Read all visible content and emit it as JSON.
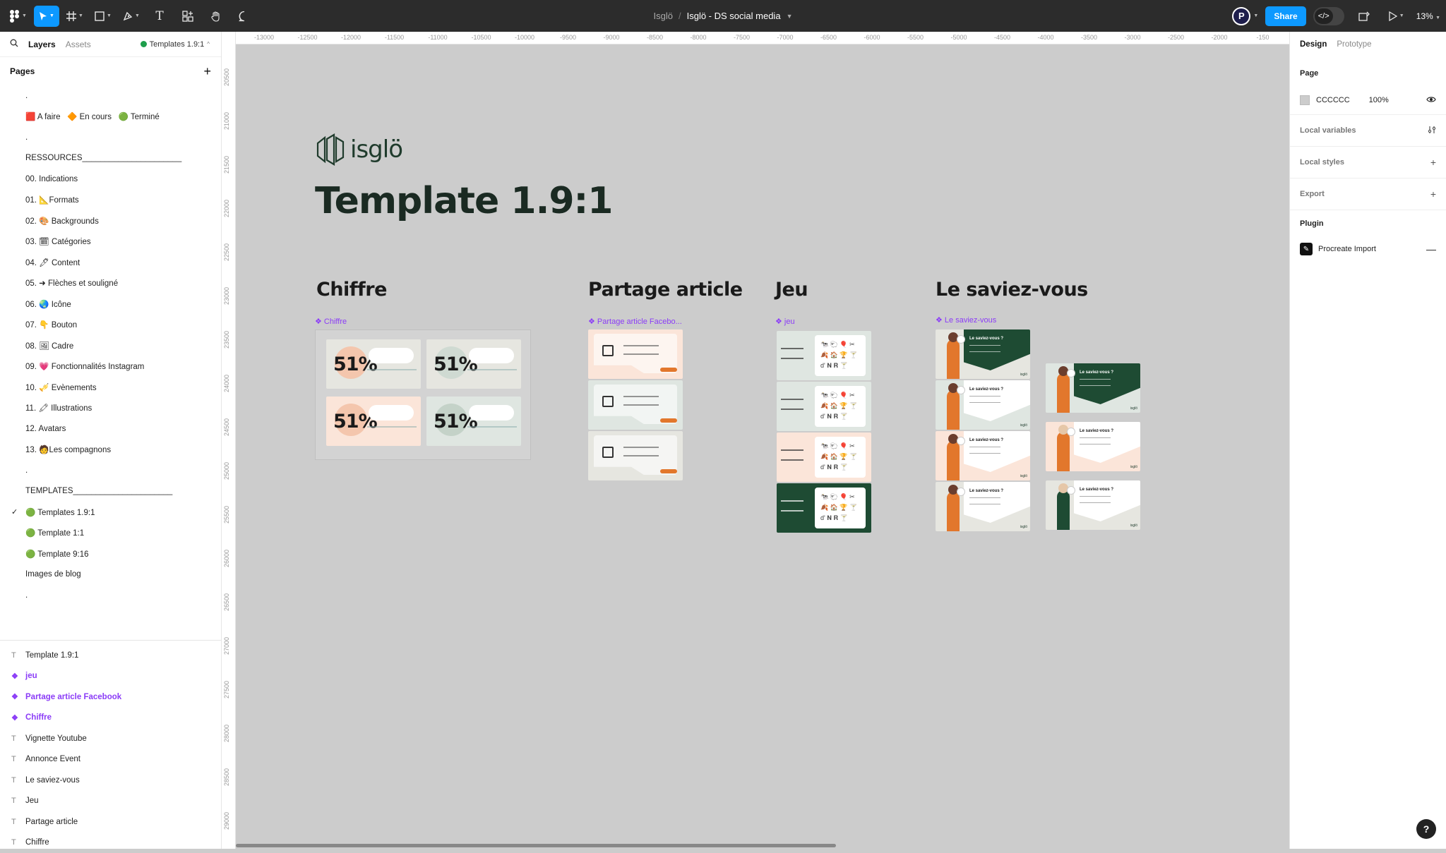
{
  "toolbar": {
    "breadcrumb_team": "Isglö",
    "breadcrumb_sep": "/",
    "breadcrumb_file": "Isglö - DS social media",
    "avatar_letter": "P",
    "share_label": "Share",
    "devmode_icon": "</>",
    "zoom_label": "13%",
    "tool_icons": [
      "figma-menu-icon",
      "move-tool-icon",
      "frame-tool-icon",
      "shape-tool-icon",
      "pen-tool-icon",
      "text-tool-icon",
      "components-icon",
      "hand-tool-icon",
      "comment-tool-icon"
    ],
    "text_tool_glyph": "T"
  },
  "left_panel": {
    "tab_layers": "Layers",
    "tab_assets": "Assets",
    "page_selector": "Templates 1.9:1",
    "pages_heading": "Pages",
    "pages": [
      ".",
      "🟥 A faire   🔶 En cours   🟢 Terminé",
      ".",
      "RESSOURCES______________________",
      "00. Indications",
      "01. 📐Formats",
      "02. 🎨 Backgrounds",
      "03. 🗓 Catégories",
      "04. 🖊 Content",
      "05. ➜ Flèches et souligné",
      "06. 🌏 Icône",
      "07. 👇 Bouton",
      "08. 🖼 Cadre",
      "09. 💗 Fonctionnalités Instagram",
      "10. 🎺 Evènements",
      "11. 🖍 Illustrations",
      "12. Avatars",
      "13. 🧑Les compagnons",
      ".",
      "TEMPLATES______________________",
      "🟢 Templates 1.9:1",
      "🟢 Template 1:1",
      "🟢 Template 9:16",
      "Images de blog",
      "."
    ],
    "active_page_index": 20,
    "layers": [
      {
        "label": "Template 1.9:1",
        "type": "text"
      },
      {
        "label": "jeu",
        "type": "component"
      },
      {
        "label": "Partage article Facebook",
        "type": "component"
      },
      {
        "label": "Chiffre",
        "type": "component"
      },
      {
        "label": "Vignette Youtube",
        "type": "text"
      },
      {
        "label": "Annonce Event",
        "type": "text"
      },
      {
        "label": "Le saviez-vous",
        "type": "text"
      },
      {
        "label": "Jeu",
        "type": "text"
      },
      {
        "label": "Partage article",
        "type": "text"
      },
      {
        "label": "Chiffre",
        "type": "text"
      }
    ]
  },
  "canvas": {
    "ruler_x": [
      "-13000",
      "-12500",
      "-12000",
      "-11500",
      "-11000",
      "-10500",
      "-10000",
      "-9500",
      "-9000",
      "-8500",
      "-8000",
      "-7500",
      "-7000",
      "-6500",
      "-6000",
      "-5500",
      "-5000",
      "-4500",
      "-4000",
      "-3500",
      "-3000",
      "-2500",
      "-2000",
      "-150"
    ],
    "ruler_y": [
      "20500",
      "21000",
      "21500",
      "22000",
      "22500",
      "23000",
      "23500",
      "24000",
      "24500",
      "25000",
      "25500",
      "26000",
      "26500",
      "27000",
      "27500",
      "28000",
      "28500",
      "29000"
    ],
    "logo_text": "isglö",
    "title": "Template 1.9:1",
    "sections": {
      "chiffre": {
        "title": "Chiffre",
        "component": "Chiffre"
      },
      "partage": {
        "title": "Partage article",
        "component": "Partage article Facebo..."
      },
      "jeu": {
        "title": "Jeu",
        "component": "jeu"
      },
      "saviez": {
        "title": "Le saviez-vous",
        "component": "Le saviez-vous"
      }
    },
    "stat_value": "51%",
    "saviez_card_title": "Le saviez-vous ?",
    "mini_logo": "isglö",
    "jeu_emoji_rows": [
      "🐄 🐑 🎈 ✂",
      "🍂 🏠 🏆 🍸",
      "d' 𝐍 𝐑 🍸"
    ],
    "colors": {
      "peach": "#fbe5d9",
      "grey_card": "#e6e6e0",
      "green_grey": "#dfe6e1",
      "dark_green": "#1e4b33",
      "orange": "#e2772c",
      "blue": "#0d99ff",
      "purple": "#8b3cf7"
    }
  },
  "right_panel": {
    "tab_design": "Design",
    "tab_prototype": "Prototype",
    "page_heading": "Page",
    "page_fill": "CCCCCC",
    "page_opacity": "100%",
    "local_variables": "Local variables",
    "local_styles": "Local styles",
    "export": "Export",
    "plugin_heading": "Plugin",
    "plugin_name": "Procreate Import",
    "help": "?"
  }
}
